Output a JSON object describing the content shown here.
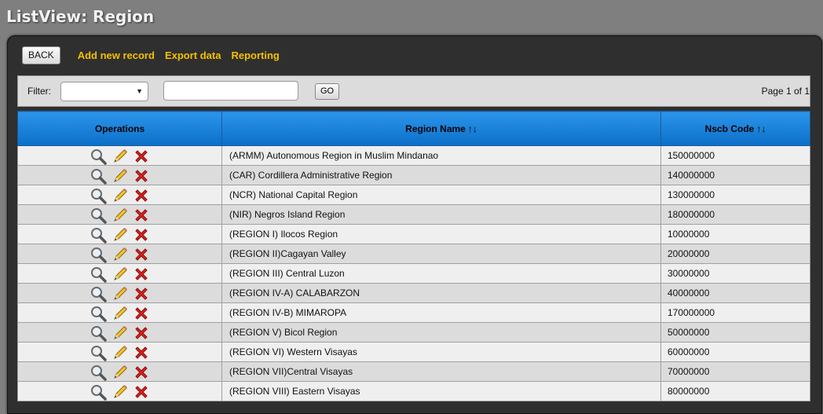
{
  "page": {
    "title": "ListView: Region"
  },
  "toolbar": {
    "back_label": "BACK",
    "links": [
      "Add new record",
      "Export data",
      "Reporting"
    ]
  },
  "filter": {
    "label": "Filter:",
    "select_value": "",
    "input_value": "",
    "go_label": "GO",
    "page_info": "Page 1 of 1"
  },
  "table": {
    "headers": [
      "Operations",
      "Region Name",
      "Nscb Code"
    ],
    "sort_glyph": "↑↓",
    "operation_icons": [
      "magnifier-view-icon",
      "pencil-edit-icon",
      "red-x-delete-icon"
    ],
    "rows": [
      {
        "name": "(ARMM) Autonomous Region in Muslim Mindanao",
        "code": "150000000"
      },
      {
        "name": "(CAR) Cordillera Administrative Region",
        "code": "140000000"
      },
      {
        "name": "(NCR) National Capital Region",
        "code": "130000000"
      },
      {
        "name": "(NIR) Negros Island Region",
        "code": "180000000"
      },
      {
        "name": "(REGION I) Ilocos Region",
        "code": "10000000"
      },
      {
        "name": "(REGION II)Cagayan Valley",
        "code": "20000000"
      },
      {
        "name": "(REGION III) Central Luzon",
        "code": "30000000"
      },
      {
        "name": "(REGION IV-A) CALABARZON",
        "code": "40000000"
      },
      {
        "name": "(REGION IV-B) MIMAROPA",
        "code": "170000000"
      },
      {
        "name": "(REGION V) Bicol Region",
        "code": "50000000"
      },
      {
        "name": "(REGION VI) Western Visayas",
        "code": "60000000"
      },
      {
        "name": "(REGION VII)Central Visayas",
        "code": "70000000"
      },
      {
        "name": "(REGION VIII) Eastern Visayas",
        "code": "80000000"
      }
    ]
  },
  "colors": {
    "header_blue": "#1a82dc",
    "link_yellow": "#f5c000",
    "delete_red": "#d8231f"
  }
}
